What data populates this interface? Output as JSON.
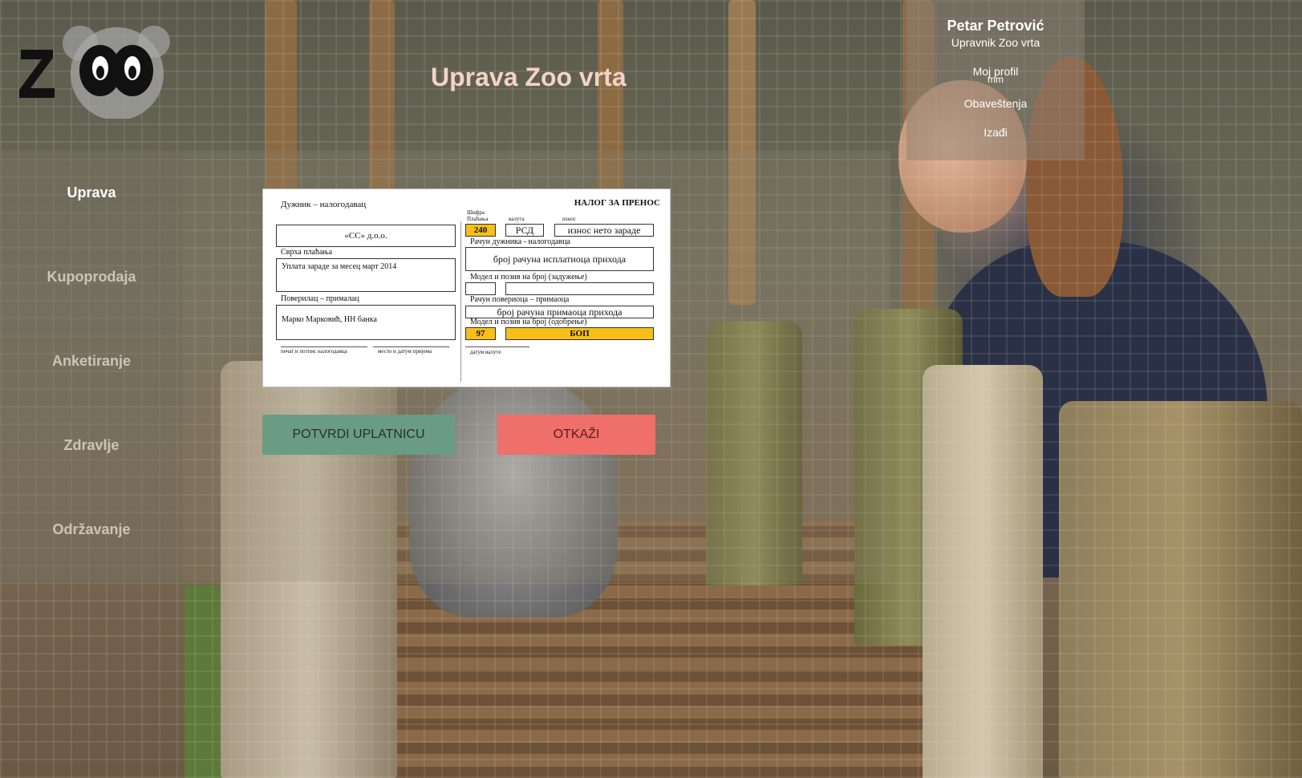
{
  "header": {
    "title": "Uprava Zoo vrta",
    "logo_text": "ZOO"
  },
  "user": {
    "name": "Petar Petrović",
    "role": "Upravnik Zoo vrta",
    "links": [
      "Moj profil",
      "Obaveštenja",
      "Izađi"
    ],
    "overlap_text": "mm"
  },
  "sidebar": {
    "items": [
      {
        "label": "Uprava",
        "active": true
      },
      {
        "label": "Kupoprodaja",
        "active": false
      },
      {
        "label": "Anketiranje",
        "active": false
      },
      {
        "label": "Zdravlje",
        "active": false
      },
      {
        "label": "Održavanje",
        "active": false
      }
    ]
  },
  "slip": {
    "payer_label": "Дужник – налогодавац",
    "title": "НАЛОГ ЗА ПРЕНОС",
    "payer_value": "«СС» д.о.о.",
    "purpose_label": "Сврха плаћања",
    "purpose_value": "Уплата зараде за месец март 2014",
    "recipient_label": "Поверилац – прималац",
    "recipient_value": "Марко Марковић, НН банка",
    "sign_label": "печат и потпис налогодавца",
    "place_date_label": "место и датум пријема",
    "code_label_1": "Шифра",
    "code_label_2": "Плаћања",
    "currency_label": "валута",
    "amount_label": "износ",
    "code_value": "240",
    "currency_value": "РСД",
    "amount_value": "износ нето зараде",
    "payer_account_label": "Рачун дужника  - налогодавца",
    "payer_account_value": "број рачуна исплатиоца прихода",
    "model_debit_label": "Модел и позив на број (задужење)",
    "creditor_account_label": "Рачун повериоца – примаоца",
    "creditor_account_value": "број рачуна примаоца прихода",
    "model_credit_label": "Модел и позив на број (одобрење)",
    "model_value": "97",
    "reference_value": "БОП",
    "value_date_label": "датум валуте"
  },
  "actions": {
    "confirm_label": "POTVRDI UPLATNICU",
    "cancel_label": "OTKAŽI"
  },
  "colors": {
    "title": "#f3d3c7",
    "confirm": "#6a9c83",
    "cancel": "#ef6f6a",
    "slip_highlight": "#f7bf17"
  }
}
